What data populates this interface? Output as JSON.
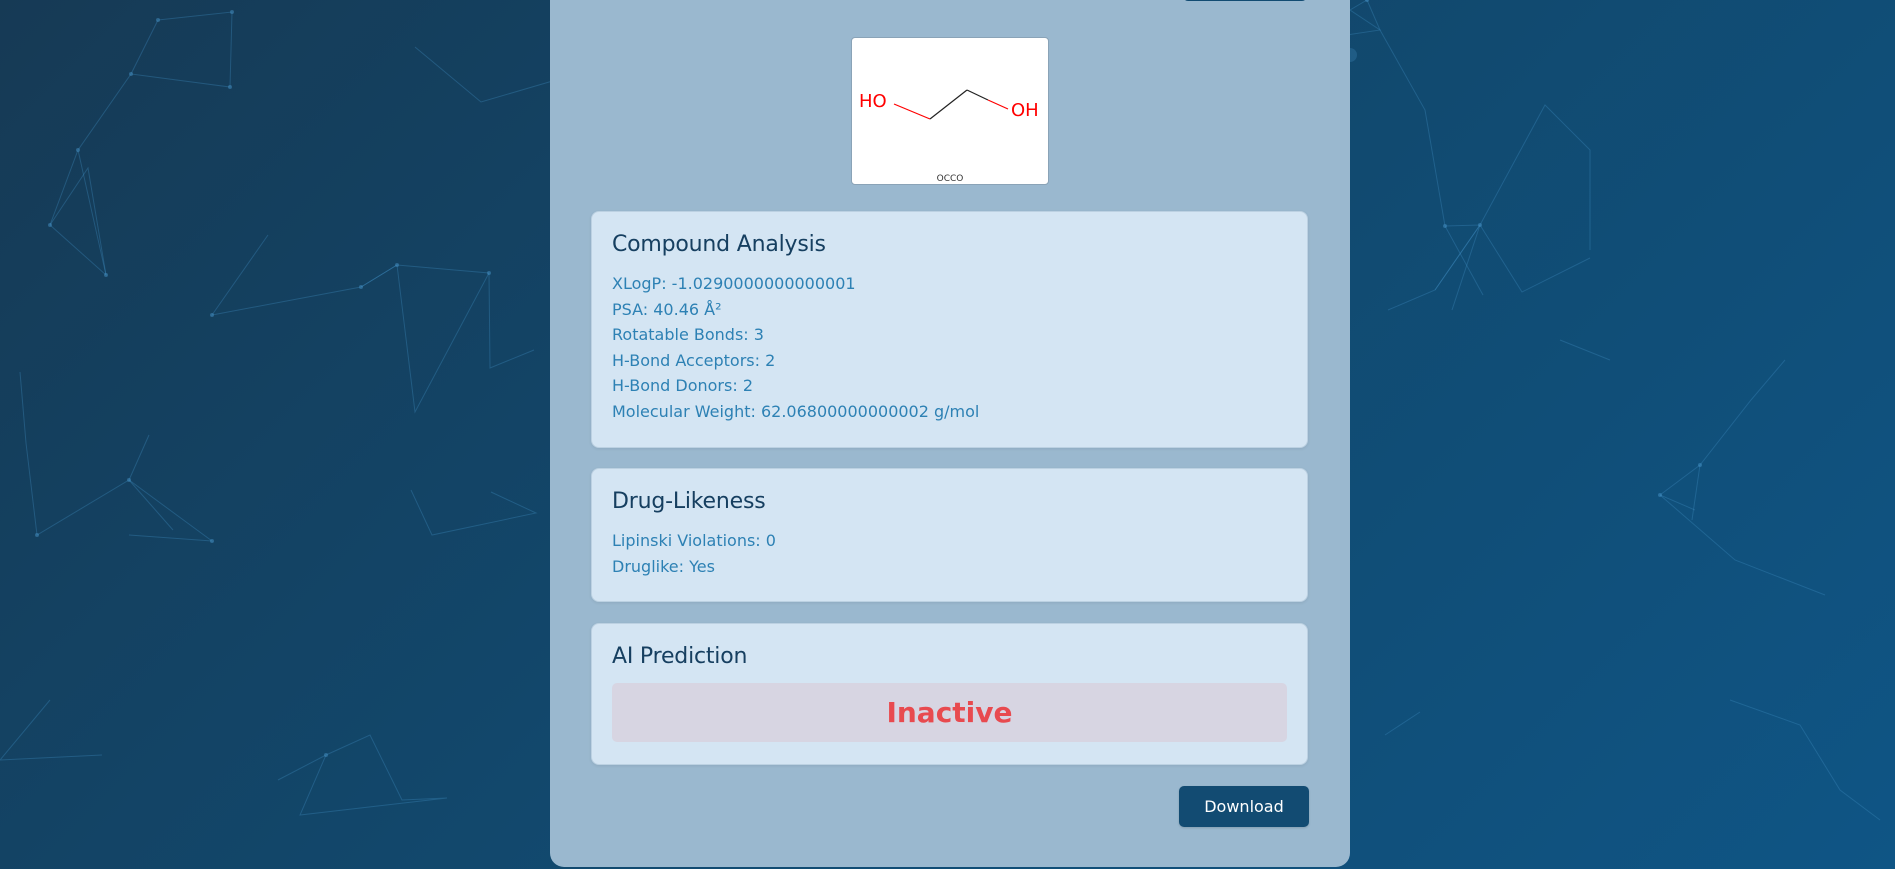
{
  "molecule": {
    "smiles_caption": "OCCO",
    "atom_left": "HO",
    "atom_right": "OH"
  },
  "compound_analysis": {
    "title": "Compound Analysis",
    "rows": [
      "XLogP: -1.0290000000000001",
      "PSA: 40.46 Å²",
      "Rotatable Bonds: 3",
      "H-Bond Acceptors: 2",
      "H-Bond Donors: 2",
      "Molecular Weight: 62.06800000000002 g/mol"
    ]
  },
  "drug_likeness": {
    "title": "Drug-Likeness",
    "rows": [
      "Lipinski Violations: 0",
      "Druglike: Yes"
    ]
  },
  "ai_prediction": {
    "title": "AI Prediction",
    "result": "Inactive"
  },
  "actions": {
    "download_label": "Download"
  },
  "colors": {
    "panel": "#9ab8cf",
    "card": "#d4e5f3",
    "button": "#124b72",
    "inactive_text": "#e84a4f",
    "heteroatom": "#ff0000"
  }
}
